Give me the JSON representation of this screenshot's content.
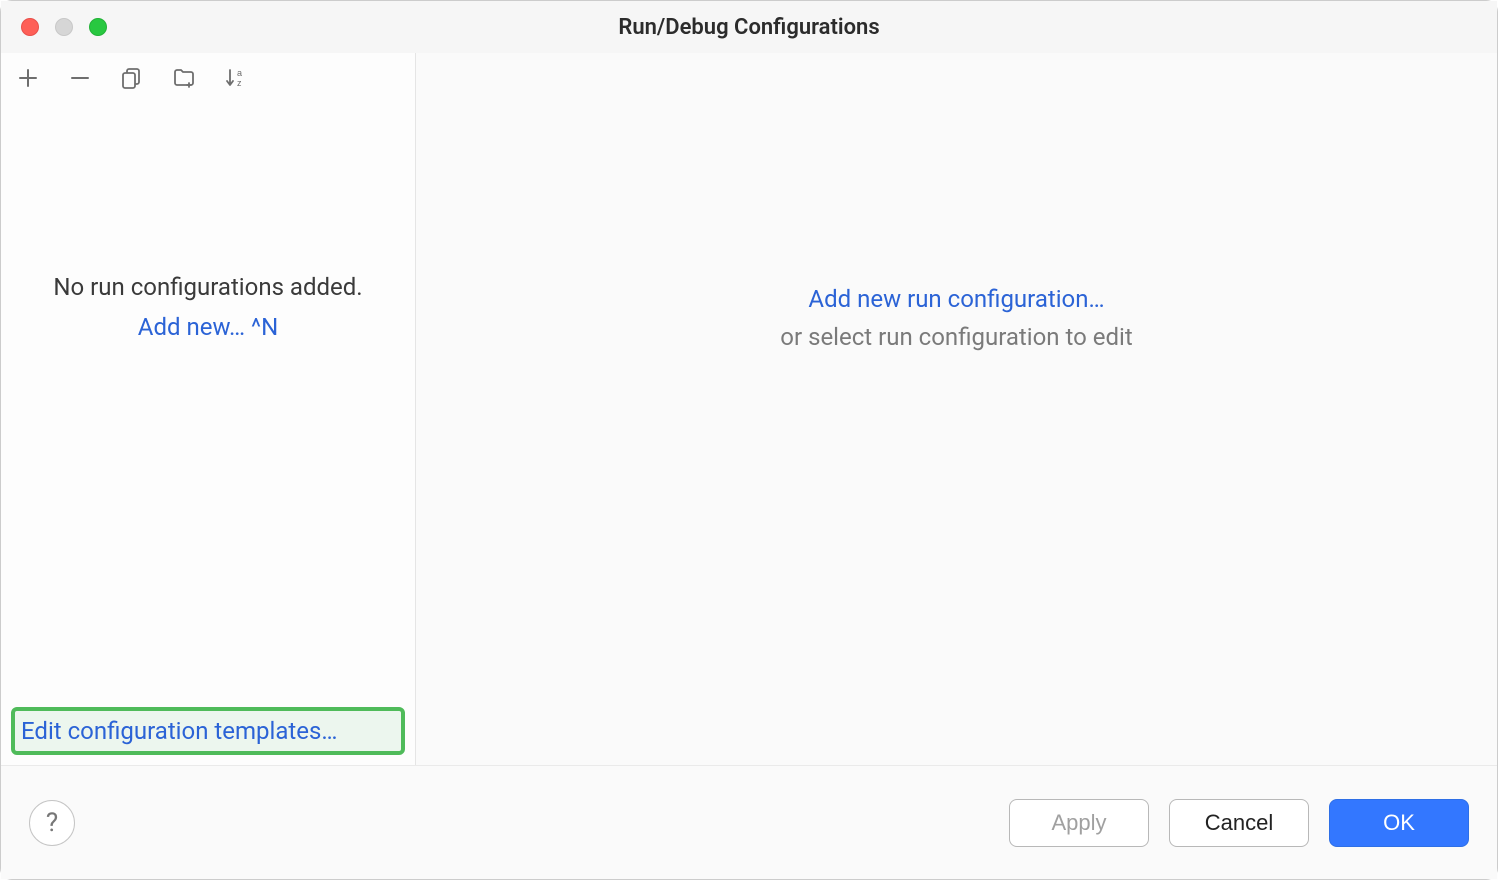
{
  "window": {
    "title": "Run/Debug Configurations"
  },
  "toolbar_icons": {
    "add": "plus-icon",
    "remove": "minus-icon",
    "copy": "copy-icon",
    "folder": "folder-add-icon",
    "sort": "sort-alpha-icon"
  },
  "sidebar": {
    "empty_message": "No run configurations added.",
    "add_new_label": "Add new… ^N",
    "edit_templates_label": "Edit configuration templates…"
  },
  "main": {
    "add_link_label": "Add new run configuration…",
    "select_hint": "or select run configuration to edit"
  },
  "footer": {
    "help_label": "?",
    "apply_label": "Apply",
    "cancel_label": "Cancel",
    "ok_label": "OK"
  }
}
